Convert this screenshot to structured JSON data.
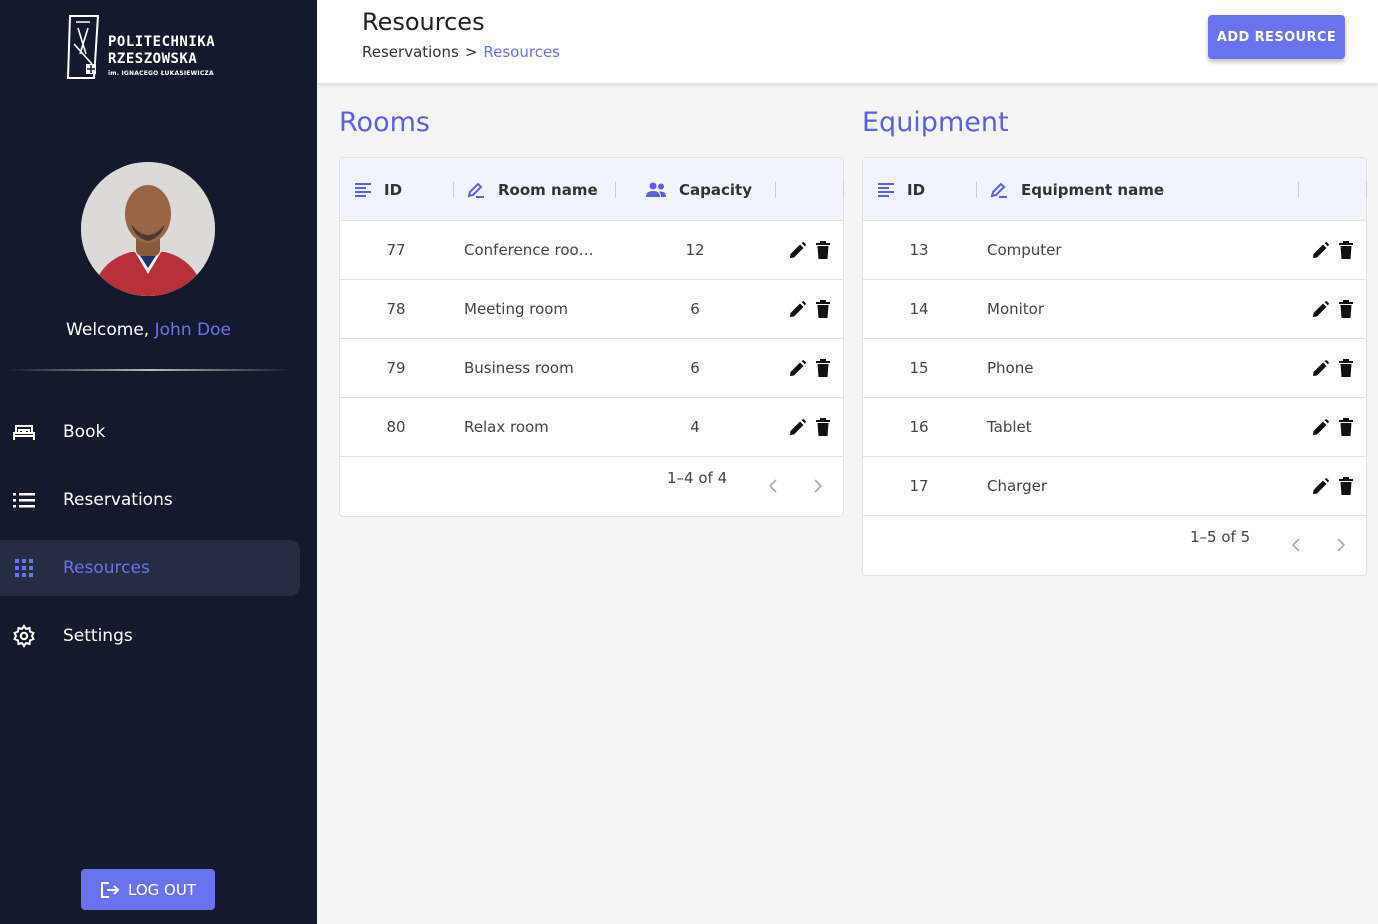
{
  "sidebar": {
    "logo": {
      "line1": "POLITECHNIKA",
      "line2": "RZESZOWSKA",
      "line3": "im. IGNACEGO ŁUKASIEWICZA"
    },
    "welcome_prefix": "Welcome,",
    "user_name": "John Doe",
    "nav": [
      {
        "label": "Book",
        "icon": "bed-icon"
      },
      {
        "label": "Reservations",
        "icon": "list-icon"
      },
      {
        "label": "Resources",
        "icon": "grid-icon",
        "active": true
      },
      {
        "label": "Settings",
        "icon": "gear-icon"
      }
    ],
    "logout_label": "LOG OUT"
  },
  "header": {
    "title": "Resources",
    "breadcrumb": {
      "parent": "Reservations",
      "separator": ">",
      "current": "Resources"
    },
    "add_button": "ADD RESOURCE"
  },
  "rooms": {
    "title": "Rooms",
    "columns": {
      "id": "ID",
      "name": "Room name",
      "capacity": "Capacity"
    },
    "rows": [
      {
        "id": "77",
        "name": "Conference roo…",
        "capacity": "12"
      },
      {
        "id": "78",
        "name": "Meeting room",
        "capacity": "6"
      },
      {
        "id": "79",
        "name": "Business room",
        "capacity": "6"
      },
      {
        "id": "80",
        "name": "Relax room",
        "capacity": "4"
      }
    ],
    "pagination": "1–4 of 4"
  },
  "equipment": {
    "title": "Equipment",
    "columns": {
      "id": "ID",
      "name": "Equipment name"
    },
    "rows": [
      {
        "id": "13",
        "name": "Computer"
      },
      {
        "id": "14",
        "name": "Monitor"
      },
      {
        "id": "15",
        "name": "Phone"
      },
      {
        "id": "16",
        "name": "Tablet"
      },
      {
        "id": "17",
        "name": "Charger"
      }
    ],
    "pagination": "1–5 of 5"
  },
  "colors": {
    "sidebar_bg": "#141a2e",
    "accent": "#6b72f0",
    "header_row_bg": "#f2f4fd"
  }
}
